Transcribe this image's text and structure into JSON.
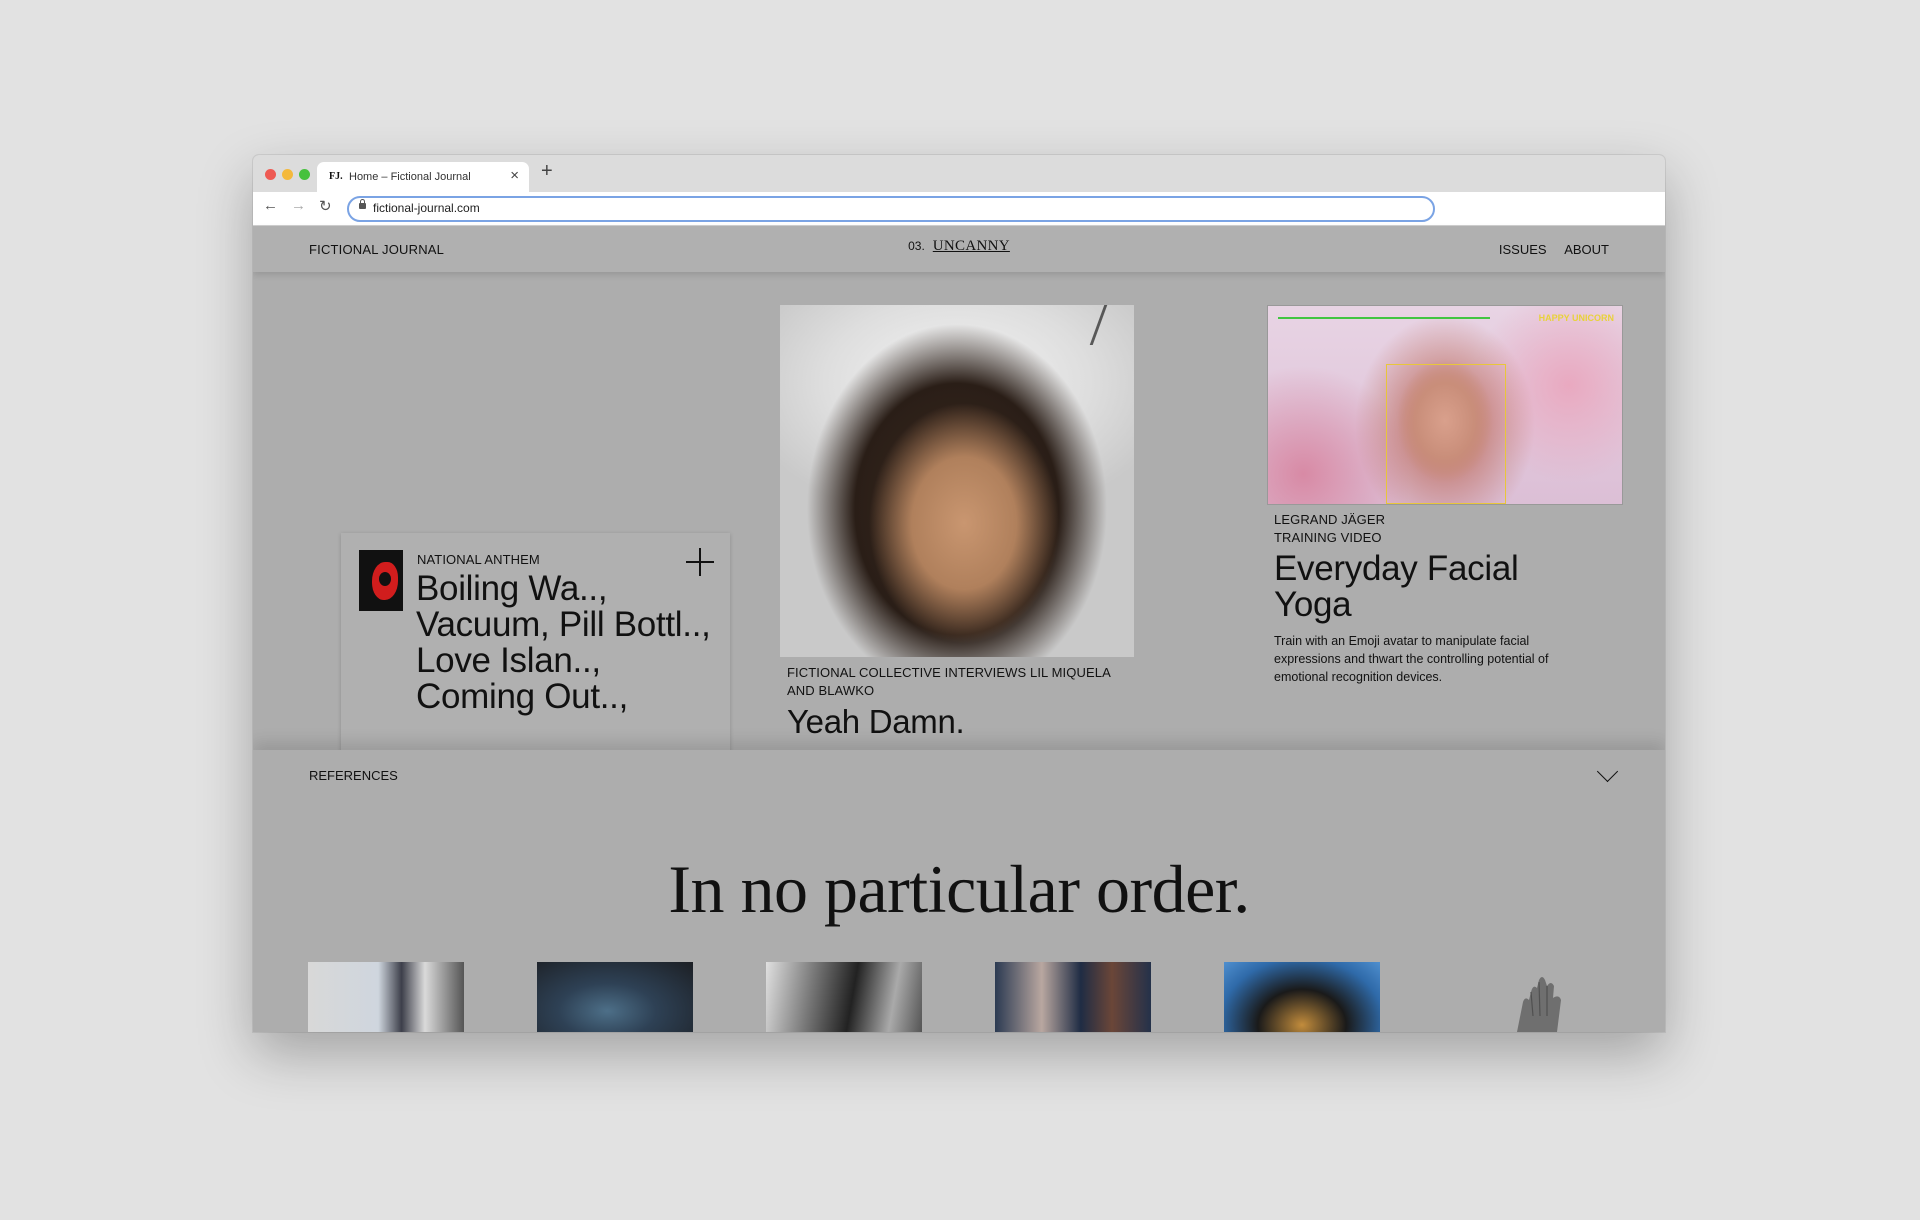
{
  "browser": {
    "tab_favicon": "FJ.",
    "tab_title": "Home – Fictional Journal",
    "tab_close": "×",
    "new_tab": "+",
    "url": "fictional-journal.com",
    "icons": [
      "back-arrow-icon",
      "forward-arrow-icon",
      "reload-icon",
      "lock-icon"
    ]
  },
  "header": {
    "brand": "FICTIONAL JOURNAL",
    "issue_number": "03.",
    "issue_name": "UNCANNY",
    "nav": [
      "ISSUES",
      "ABOUT"
    ]
  },
  "cards": {
    "left": {
      "kicker": "NATIONAL ANTHEM",
      "title": "Boiling Wa.., Vacuum, Pill Bottl.., Love Islan.., Coming Out..,"
    },
    "middle": {
      "kicker": "FICTIONAL COLLECTIVE INTERVIEWS LIL MIQUELA AND BLAWKO",
      "title": "Yeah Damn."
    },
    "right": {
      "kicker_line1": "LEGRAND JÄGER",
      "kicker_line2": "TRAINING VIDEO",
      "title": "Everyday Facial Yoga",
      "excerpt": "Train with an Emoji avatar to manipulate facial expressions and thwart the controlling potential of emotional recognition devices.",
      "overlay_tag": "HAPPY UNICORN"
    }
  },
  "references": {
    "label": "REFERENCES",
    "heading": "In no particular order."
  },
  "colors": {
    "page_bg": "#e2e2e2",
    "site_bg": "#adadad",
    "text": "#111111",
    "accent_red": "#d11d1d",
    "url_focus": "#7aa3e4"
  }
}
